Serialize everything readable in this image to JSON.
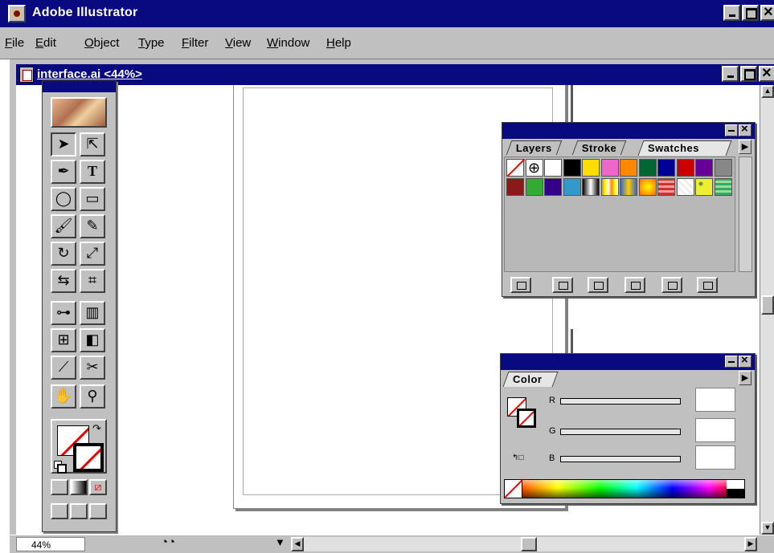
{
  "app": {
    "title": "Adobe Illustrator"
  },
  "menu": [
    "File",
    "Edit",
    "Object",
    "Type",
    "Filter",
    "View",
    "Window",
    "Help"
  ],
  "document": {
    "title": "interface.ai <44%>",
    "zoom": "44%"
  },
  "swatches_palette": {
    "tabs": [
      "Layers",
      "Stroke",
      "Swatches"
    ],
    "active_tab": "Swatches",
    "row1": [
      "none",
      "registration",
      "#ffffff",
      "#000000",
      "#ffdd00",
      "#ee66cc",
      "#ff8800",
      "#006633",
      "#000099",
      "#cc0000",
      "#660099",
      "#888888"
    ],
    "row2": [
      "#8a1a1a",
      "#33aa33",
      "#330088",
      "#3399cc",
      "gradient-bw",
      "gradient-rainbow",
      "gradient-blue",
      "gradient-orange",
      "pattern-red",
      "pattern-white",
      "pattern-yellow",
      "pattern-green"
    ]
  },
  "color_palette": {
    "tab": "Color",
    "channels": [
      "R",
      "G",
      "B"
    ]
  }
}
